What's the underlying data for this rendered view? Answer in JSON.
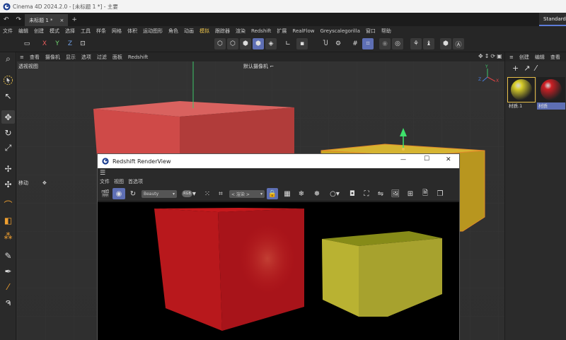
{
  "window": {
    "title": "Cinema 4D 2024.2.0 - [未标题 1 *] - 主要"
  },
  "tabs": {
    "home_icon": "undo-icon",
    "doc_tab": "未标题 1 *",
    "close": "×",
    "add": "+",
    "layout": "Standard"
  },
  "menubar": {
    "items": [
      "文件",
      "编辑",
      "创建",
      "模式",
      "选择",
      "工具",
      "样条",
      "网格",
      "体积",
      "运动图形",
      "角色",
      "动画",
      "模拟",
      "跟踪器",
      "渲染",
      "Redshift",
      "扩展",
      "RealFlow",
      "Greyscalegorilla",
      "窗口",
      "帮助"
    ],
    "highlight_index": 12
  },
  "toolbar": {
    "x_label": "X",
    "y_label": "Y",
    "z_label": "Z"
  },
  "viewport": {
    "menu": [
      "查看",
      "摄像机",
      "显示",
      "选项",
      "过滤",
      "面板",
      "Redshift"
    ],
    "label": "透视视图",
    "camera": "默认摄像机",
    "move_label": "移动",
    "axis_y": "Y",
    "axis_z": "Z",
    "axis_x": "X"
  },
  "objpanel": {
    "menu": [
      "创建",
      "编辑",
      "查看"
    ],
    "materials": [
      {
        "name": "材质.1",
        "color": "#d9cf2a"
      },
      {
        "name": "材质",
        "color": "#cc1f24"
      }
    ]
  },
  "renderview": {
    "title": "Redshift RenderView",
    "menu": [
      "文件",
      "视图",
      "首选项"
    ],
    "aov": "Beauty",
    "rgb": "RGB",
    "stage": "< 渲染 >",
    "minimize": "—",
    "maximize": "☐",
    "close": "✕"
  },
  "colors": {
    "accent": "#5e6fb4",
    "red_cube": "#cf4a48",
    "yellow_cube": "#c9a722",
    "render_red": "#b8181c",
    "render_yellow": "#b9b232"
  }
}
